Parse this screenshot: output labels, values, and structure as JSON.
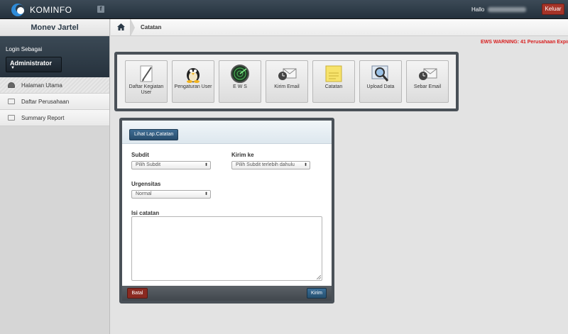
{
  "header": {
    "brand": "KOMINFO",
    "fb_icon": "f",
    "greeting": "Hallo",
    "logout_label": "Keluar"
  },
  "sidebar": {
    "title": "Monev Jartel",
    "login_label": "Login Sebagai",
    "role": "Administrator",
    "items": [
      {
        "label": "Halaman Utama",
        "icon": "home-icon"
      },
      {
        "label": "Daftar Perusahaan",
        "icon": "list-icon"
      },
      {
        "label": "Summary Report",
        "icon": "report-icon"
      }
    ]
  },
  "breadcrumb": {
    "current": "Catatan"
  },
  "warning": "EWS WARNING: 41 Perusahaan Expired",
  "tiles": [
    {
      "label": "Daftar Kegiatan User",
      "icon": "pencil-icon"
    },
    {
      "label": "Pengaturan User",
      "icon": "penguin-icon"
    },
    {
      "label": "E W S",
      "icon": "radar-icon"
    },
    {
      "label": "Kirim Email",
      "icon": "email-icon"
    },
    {
      "label": "Catatan",
      "icon": "note-icon"
    },
    {
      "label": "Upload Data",
      "icon": "magnifier-icon"
    },
    {
      "label": "Sebar Email",
      "icon": "email-icon"
    }
  ],
  "form": {
    "view_report_label": "Lihat Lap.Catatan",
    "subdit_label": "Subdit",
    "subdit_value": "Pilih Subdit",
    "kirim_ke_label": "Kirim ke",
    "kirim_ke_value": "Pilih Subdit terlebih dahulu",
    "urgensitas_label": "Urgensitas",
    "urgensitas_value": "Normal",
    "isi_label": "Isi catatan",
    "isi_value": "",
    "cancel_label": "Batal",
    "submit_label": "Kirim"
  },
  "colors": {
    "topbar": "#24313d",
    "danger": "#a63428",
    "primary": "#284d6d",
    "warning_text": "#d81e1e"
  }
}
